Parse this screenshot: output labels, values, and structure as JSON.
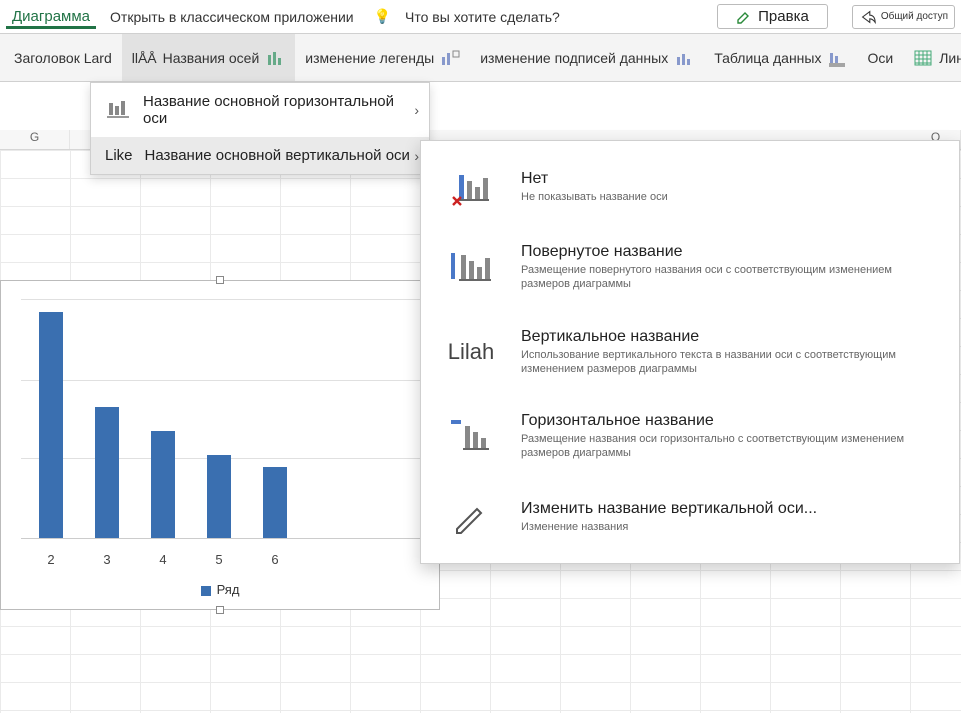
{
  "ribbon": {
    "tab_chart": "Диаграмма",
    "open_desktop": "Открыть в классическом приложении",
    "tell_me": "Что вы хотите сделать?",
    "edit": "Правка",
    "share": "Общий доступ"
  },
  "tools": {
    "chart_title_prefix": "Заголовок Lard",
    "axis_titles_prefix": "llÅÅ",
    "axis_titles": "Названия осей",
    "legend": "изменение легенды",
    "data_labels": "изменение подписей данных",
    "data_table": "Таблица данных",
    "axes": "Оси",
    "gridlines": "Линии сетки"
  },
  "submenu1": {
    "horizontal": "Название основной горизонтальной оси",
    "vertical_prefix": "Like",
    "vertical": "Название основной вертикальной оси"
  },
  "submenu2": {
    "none_title": "Нет",
    "none_desc": "Не показывать название оси",
    "rotated_title": "Повернутое название",
    "rotated_desc": "Размещение повернутого названия оси с соответствующим изменением размеров диаграммы",
    "vertical_title": "Вертикальное название",
    "vertical_desc": "Использование вертикального текста в названии оси с соответствующим изменением размеров диаграммы",
    "vertical_prefix": "Lilah",
    "horizontal_title": "Горизонтальное название",
    "horizontal_desc": "Размещение названия оси горизонтально с соответствующим изменением размеров диаграммы",
    "edit_title": "Изменить название вертикальной оси...",
    "edit_desc": "Изменение названия"
  },
  "columns": {
    "g": "G",
    "q": "Q"
  },
  "chart_data": {
    "type": "bar",
    "categories": [
      "2",
      "3",
      "4",
      "5",
      "6"
    ],
    "values": [
      95,
      55,
      45,
      35,
      30
    ],
    "series_name": "Ряд",
    "ylim": [
      0,
      100
    ],
    "gridlines": [
      0,
      33,
      66,
      100
    ]
  }
}
